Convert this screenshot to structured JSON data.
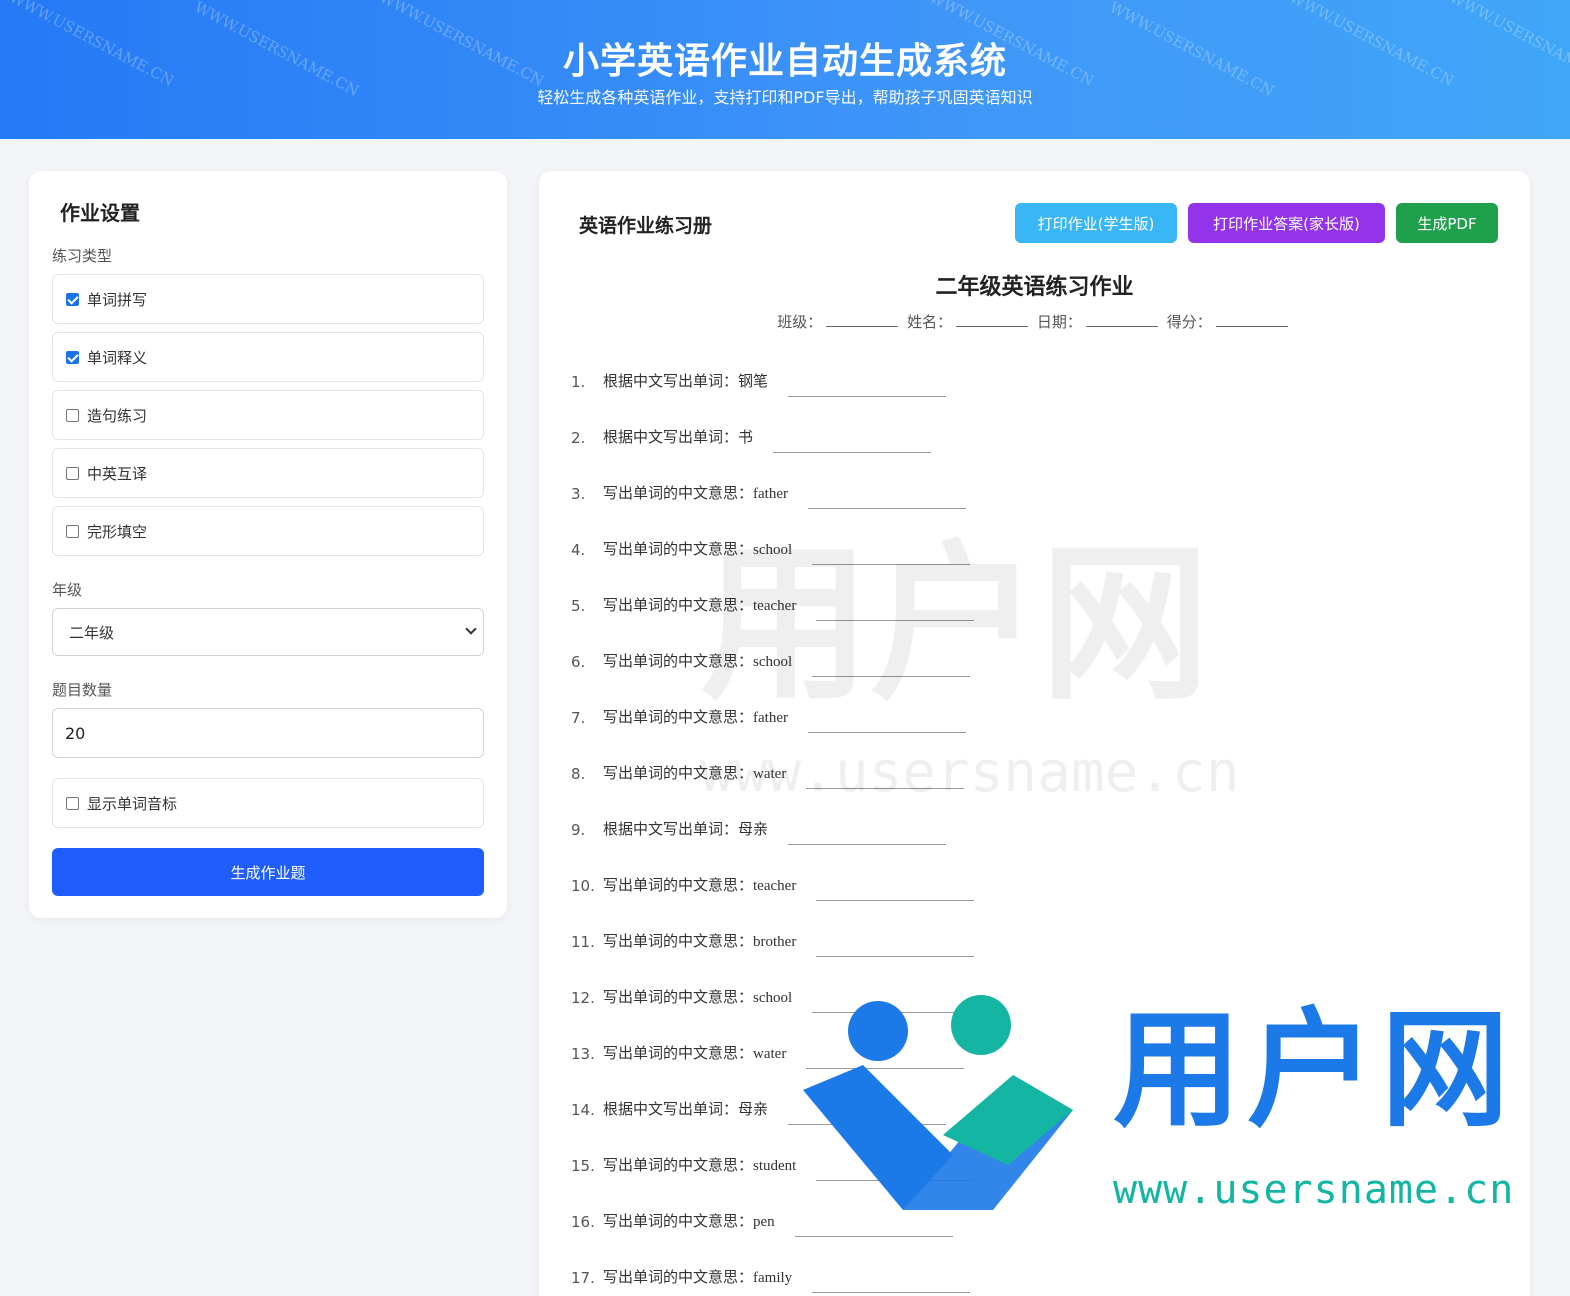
{
  "header": {
    "title": "小学英语作业自动生成系统",
    "subtitle": "轻松生成各种英语作业，支持打印和PDF导出，帮助孩子巩固英语知识",
    "watermark": "WWW.USERSNAME.CN"
  },
  "settings": {
    "title": "作业设置",
    "practice_type_label": "练习类型",
    "options": [
      {
        "label": "单词拼写",
        "checked": true
      },
      {
        "label": "单词释义",
        "checked": true
      },
      {
        "label": "造句练习",
        "checked": false
      },
      {
        "label": "中英互译",
        "checked": false
      },
      {
        "label": "完形填空",
        "checked": false
      }
    ],
    "grade_label": "年级",
    "grade_value": "二年级",
    "count_label": "题目数量",
    "count_value": "20",
    "phonetic_label": "显示单词音标",
    "phonetic_checked": false,
    "generate_label": "生成作业题"
  },
  "workbook": {
    "title": "英语作业练习册",
    "print_student_label": "打印作业(学生版)",
    "print_parent_label": "打印作业答案(家长版)",
    "pdf_label": "生成PDF",
    "sheet_title": "二年级英语练习作业",
    "info": {
      "class": "班级：",
      "name": "姓名：",
      "date": "日期：",
      "score": "得分："
    },
    "questions": [
      {
        "num": "1.",
        "prompt": "根据中文写出单词：",
        "word": "钢笔"
      },
      {
        "num": "2.",
        "prompt": "根据中文写出单词：",
        "word": "书"
      },
      {
        "num": "3.",
        "prompt": "写出单词的中文意思：",
        "word": "father"
      },
      {
        "num": "4.",
        "prompt": "写出单词的中文意思：",
        "word": "school"
      },
      {
        "num": "5.",
        "prompt": "写出单词的中文意思：",
        "word": "teacher"
      },
      {
        "num": "6.",
        "prompt": "写出单词的中文意思：",
        "word": "school"
      },
      {
        "num": "7.",
        "prompt": "写出单词的中文意思：",
        "word": "father"
      },
      {
        "num": "8.",
        "prompt": "写出单词的中文意思：",
        "word": "water"
      },
      {
        "num": "9.",
        "prompt": "根据中文写出单词：",
        "word": "母亲"
      },
      {
        "num": "10.",
        "prompt": "写出单词的中文意思：",
        "word": "teacher"
      },
      {
        "num": "11.",
        "prompt": "写出单词的中文意思：",
        "word": "brother"
      },
      {
        "num": "12.",
        "prompt": "写出单词的中文意思：",
        "word": "school"
      },
      {
        "num": "13.",
        "prompt": "写出单词的中文意思：",
        "word": "water"
      },
      {
        "num": "14.",
        "prompt": "根据中文写出单词：",
        "word": "母亲"
      },
      {
        "num": "15.",
        "prompt": "写出单词的中文意思：",
        "word": "student"
      },
      {
        "num": "16.",
        "prompt": "写出单词的中文意思：",
        "word": "pen"
      },
      {
        "num": "17.",
        "prompt": "写出单词的中文意思：",
        "word": "family"
      }
    ]
  },
  "watermark_logo": {
    "cn": "用户网",
    "url": "www.usersname.cn"
  },
  "colors": {
    "header_start": "#2579f6",
    "header_end": "#40a6f9",
    "primary": "#1f5efc",
    "student_btn": "#38b6f5",
    "parent_btn": "#9333ea",
    "pdf_btn": "#1fa04c"
  }
}
